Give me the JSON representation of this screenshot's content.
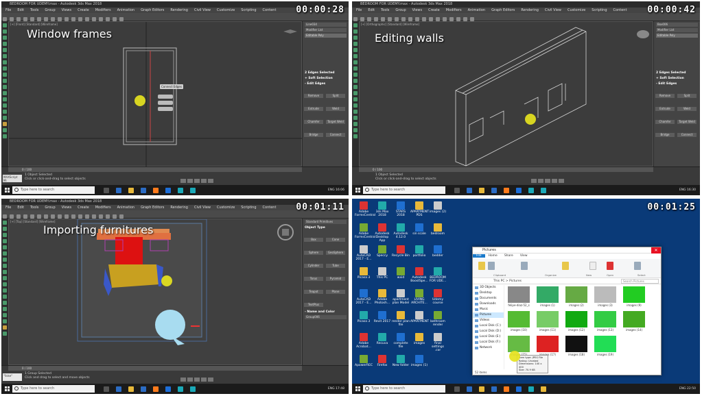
{
  "tiles": [
    {
      "timestamp": "00:00:28",
      "window_title": "BEDROOM FOR UDEMY.max - Autodesk 3ds Max 2018",
      "caption": "Window frames",
      "viewport_label": "[+] [Front] [Standard] [Wireframe]",
      "modifier": "Editable Poly",
      "panel_status": "2 Edges Selected",
      "popup": "Connect Edges",
      "status_line_1": "1 Object Selected",
      "status_line_2": "Click or click-and-drag to select objects",
      "frame_counter": "0 / 100",
      "clock": "16:06"
    },
    {
      "timestamp": "00:00:42",
      "window_title": "BEDROOM FOR UDEMY.max - Autodesk 3ds Max 2018",
      "caption": "Editing walls",
      "viewport_label": "[+] [Orthographic] [Standard] [Wireframe]",
      "modifier": "Editable Poly",
      "panel_status": "2 Edges Selected",
      "status_line_1": "1 Object Selected",
      "status_line_2": "Click or click-and-drag to select objects",
      "frame_counter": "0 / 100",
      "clock": "16:30"
    },
    {
      "timestamp": "00:01:11",
      "window_title": "BEDROOM FOR UDEMY.max - Autodesk 3ds Max 2018",
      "caption": "Importing furnitures",
      "viewport_label": "[+] [Top] [Standard] [Wireframe]",
      "panel_status": "Object Type",
      "status_line_1": "1 Group Selected",
      "status_line_2": "Click and drag to select and move objects",
      "maxscript": "\"false\"",
      "frame_counter": "0 / 100",
      "clock": "17:48"
    },
    {
      "timestamp": "00:01:25",
      "explorer_title": "Pictures",
      "address": "This PC > Pictures",
      "search_placeholder": "Search Pictures",
      "item_count": "52 items",
      "clock": "22:50",
      "search_taskbar": "Type here to search"
    }
  ],
  "ribbon_sections": [
    "Clipboard",
    "Organize",
    "New",
    "Open",
    "Select"
  ],
  "nav_items": [
    "3D Objects",
    "Desktop",
    "Documents",
    "Downloads",
    "Music",
    "Pictures",
    "Videos",
    "Local Disk (C:)",
    "Local Disk (D:)",
    "Local Disk (E:)",
    "Local Disk (F:)",
    "Network"
  ],
  "thumb_labels": [
    "felipe-diaz-52_s",
    "images (1)",
    "images (2)",
    "images (3)",
    "images (9)",
    "images (10)",
    "images (11)",
    "images (12)",
    "images (13)",
    "images (14)",
    "images (15)",
    "images (17)",
    "images (18)",
    "images (19)"
  ],
  "desktop_icons": [
    "Adobe FormsCentral",
    "3ds Max 2018",
    "STARS 2018",
    "APARTMENT PDS",
    "images (2)",
    "Adobe FormsCentral",
    "Autodesk Desktop App",
    "Autodesk 4.12.0",
    "sin scale",
    "bedroom",
    "AutoCAD 2017 - E...",
    "Speccy",
    "Recycle Bin",
    "portfolio",
    "bedder",
    "Picasa 3",
    "This PC",
    "wxid",
    "Autodesk BoostSpe...",
    "BEDROOM FOR UDE...",
    "AutoCAD 2017 - E...",
    "Adobe Photosh...",
    "apartment plan Model",
    "LIVING ARCHITE...",
    "Udemy course",
    "Picasa 3",
    "Revit 2017",
    "render plan file",
    "APARTMENT",
    "bathroom render",
    "Adobe Acrobat...",
    "Recuva",
    "complete file",
    "images",
    "final settings .cor",
    "ApowerREC",
    "Firefox",
    "New folder",
    "images (1)"
  ],
  "taskbar_search": "Type here to search",
  "lang": "ENG"
}
